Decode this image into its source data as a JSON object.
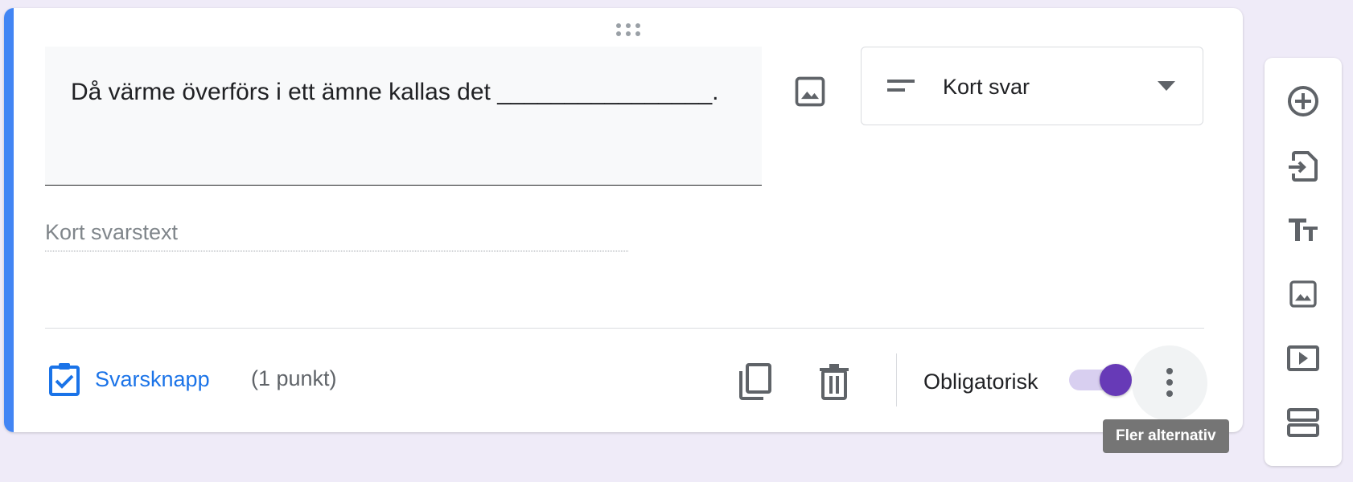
{
  "question": {
    "text": "Då värme överförs i ett ämne kallas det ________________.",
    "type_label": "Kort svar",
    "answer_placeholder": "Kort svarstext"
  },
  "footer": {
    "answer_key_label": "Svarsknapp",
    "points_label": "(1 punkt)",
    "required_label": "Obligatorisk",
    "required_on": true
  },
  "tooltip": {
    "text": "Fler alternativ"
  },
  "icons": {
    "drag": "drag-handle-icon",
    "image": "image-icon",
    "short_answer": "short-text-icon",
    "dropdown": "arrow-drop-down-icon",
    "answer_key": "assignment-check-icon",
    "copy": "copy-icon",
    "delete": "trash-icon",
    "more": "more-vert-icon",
    "side_toolbar": [
      "add-circle-icon",
      "import-icon",
      "title-icon",
      "image-icon",
      "video-icon",
      "section-icon"
    ]
  },
  "colors": {
    "accent": "#4285f4",
    "toggle": "#673ab7",
    "link": "#1a73e8",
    "background": "#efebf8"
  }
}
